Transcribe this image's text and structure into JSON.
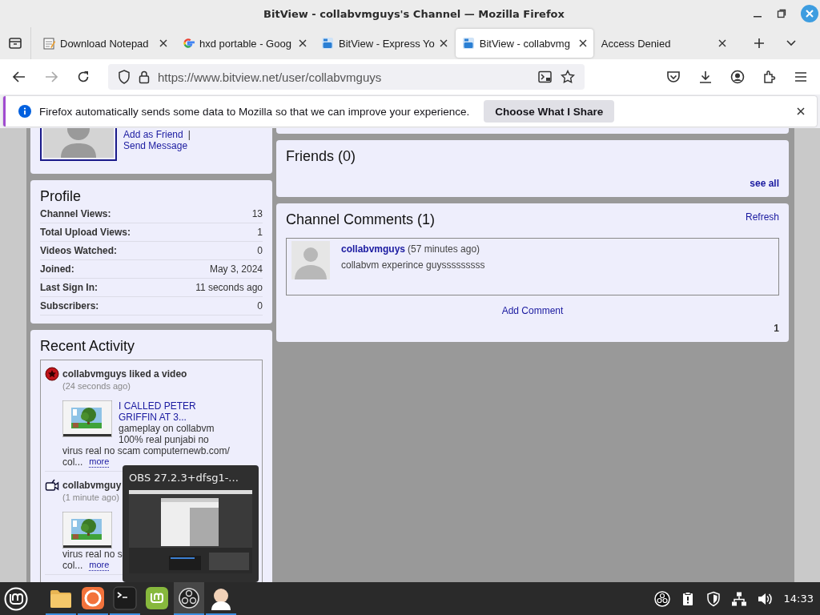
{
  "window": {
    "title": "BitView - collabvmguys's Channel — Mozilla Firefox"
  },
  "tabs": [
    {
      "label": "Download Notepad",
      "kind": "notepad",
      "selected": false
    },
    {
      "label": "hxd portable - Goog",
      "kind": "google",
      "selected": false
    },
    {
      "label": "BitView - Express Yo",
      "kind": "bitview",
      "selected": false
    },
    {
      "label": "BitView - collabvmg",
      "kind": "bitview",
      "selected": true
    },
    {
      "label": "Access Denied",
      "kind": "plain",
      "selected": false
    }
  ],
  "address_bar": {
    "url": "https://www.bitview.net/user/collabvmguys"
  },
  "notification": {
    "message": "Firefox automatically sends some data to Mozilla so that we can improve your experience.",
    "button": "Choose What I Share"
  },
  "channel_card": {
    "links": [
      "Add as Friend",
      "Send Message"
    ],
    "separator": "|"
  },
  "profile": {
    "title": "Profile",
    "rows": [
      {
        "label": "Channel Views:",
        "value": "13"
      },
      {
        "label": "Total Upload Views:",
        "value": "1"
      },
      {
        "label": "Videos Watched:",
        "value": "0"
      },
      {
        "label": "Joined:",
        "value": "May 3, 2024"
      },
      {
        "label": "Last Sign In:",
        "value": "11 seconds ago"
      },
      {
        "label": "Subscribers:",
        "value": "0"
      }
    ]
  },
  "recent_activity": {
    "title": "Recent Activity",
    "items": [
      {
        "kind": "like",
        "headline": "collabvmguys liked a video",
        "time": "(24 seconds ago)",
        "video_title": "I CALLED PETER GRIFFIN AT 3...",
        "side_lines": [
          "gameplay on collabvm",
          "100% real punjabi no"
        ],
        "lines": [
          "virus real no scam computernewb.com/",
          "col..."
        ],
        "more": "more"
      },
      {
        "kind": "upload",
        "headline": "collabvmguy",
        "time": "(1 minute ago)",
        "lines": [
          "virus real no s",
          "col..."
        ],
        "more": "more"
      }
    ]
  },
  "friends": {
    "title": "Friends (0)",
    "see_all": "see all"
  },
  "comments": {
    "title": "Channel Comments (1)",
    "refresh": "Refresh",
    "items": [
      {
        "author": "collabvmguys",
        "time": "(57 minutes ago)",
        "text": "collabvm experince guysssssssss"
      }
    ],
    "add": "Add Comment",
    "page": "1"
  },
  "tooltip": {
    "title": "OBS 27.2.3+dfsg1-..."
  },
  "taskbar": {
    "apps": [
      {
        "kind": "files",
        "running": true,
        "active": false
      },
      {
        "kind": "firefox",
        "running": true,
        "active": false
      },
      {
        "kind": "terminal",
        "running": true,
        "active": false
      },
      {
        "kind": "mint",
        "running": false,
        "active": false
      },
      {
        "kind": "obs",
        "running": true,
        "active": true
      },
      {
        "kind": "character",
        "running": true,
        "active": false
      }
    ],
    "tray": [
      {
        "kind": "obs"
      },
      {
        "kind": "clipboard"
      },
      {
        "kind": "shield"
      },
      {
        "kind": "network"
      },
      {
        "kind": "volume"
      }
    ],
    "clock": "14:33"
  }
}
